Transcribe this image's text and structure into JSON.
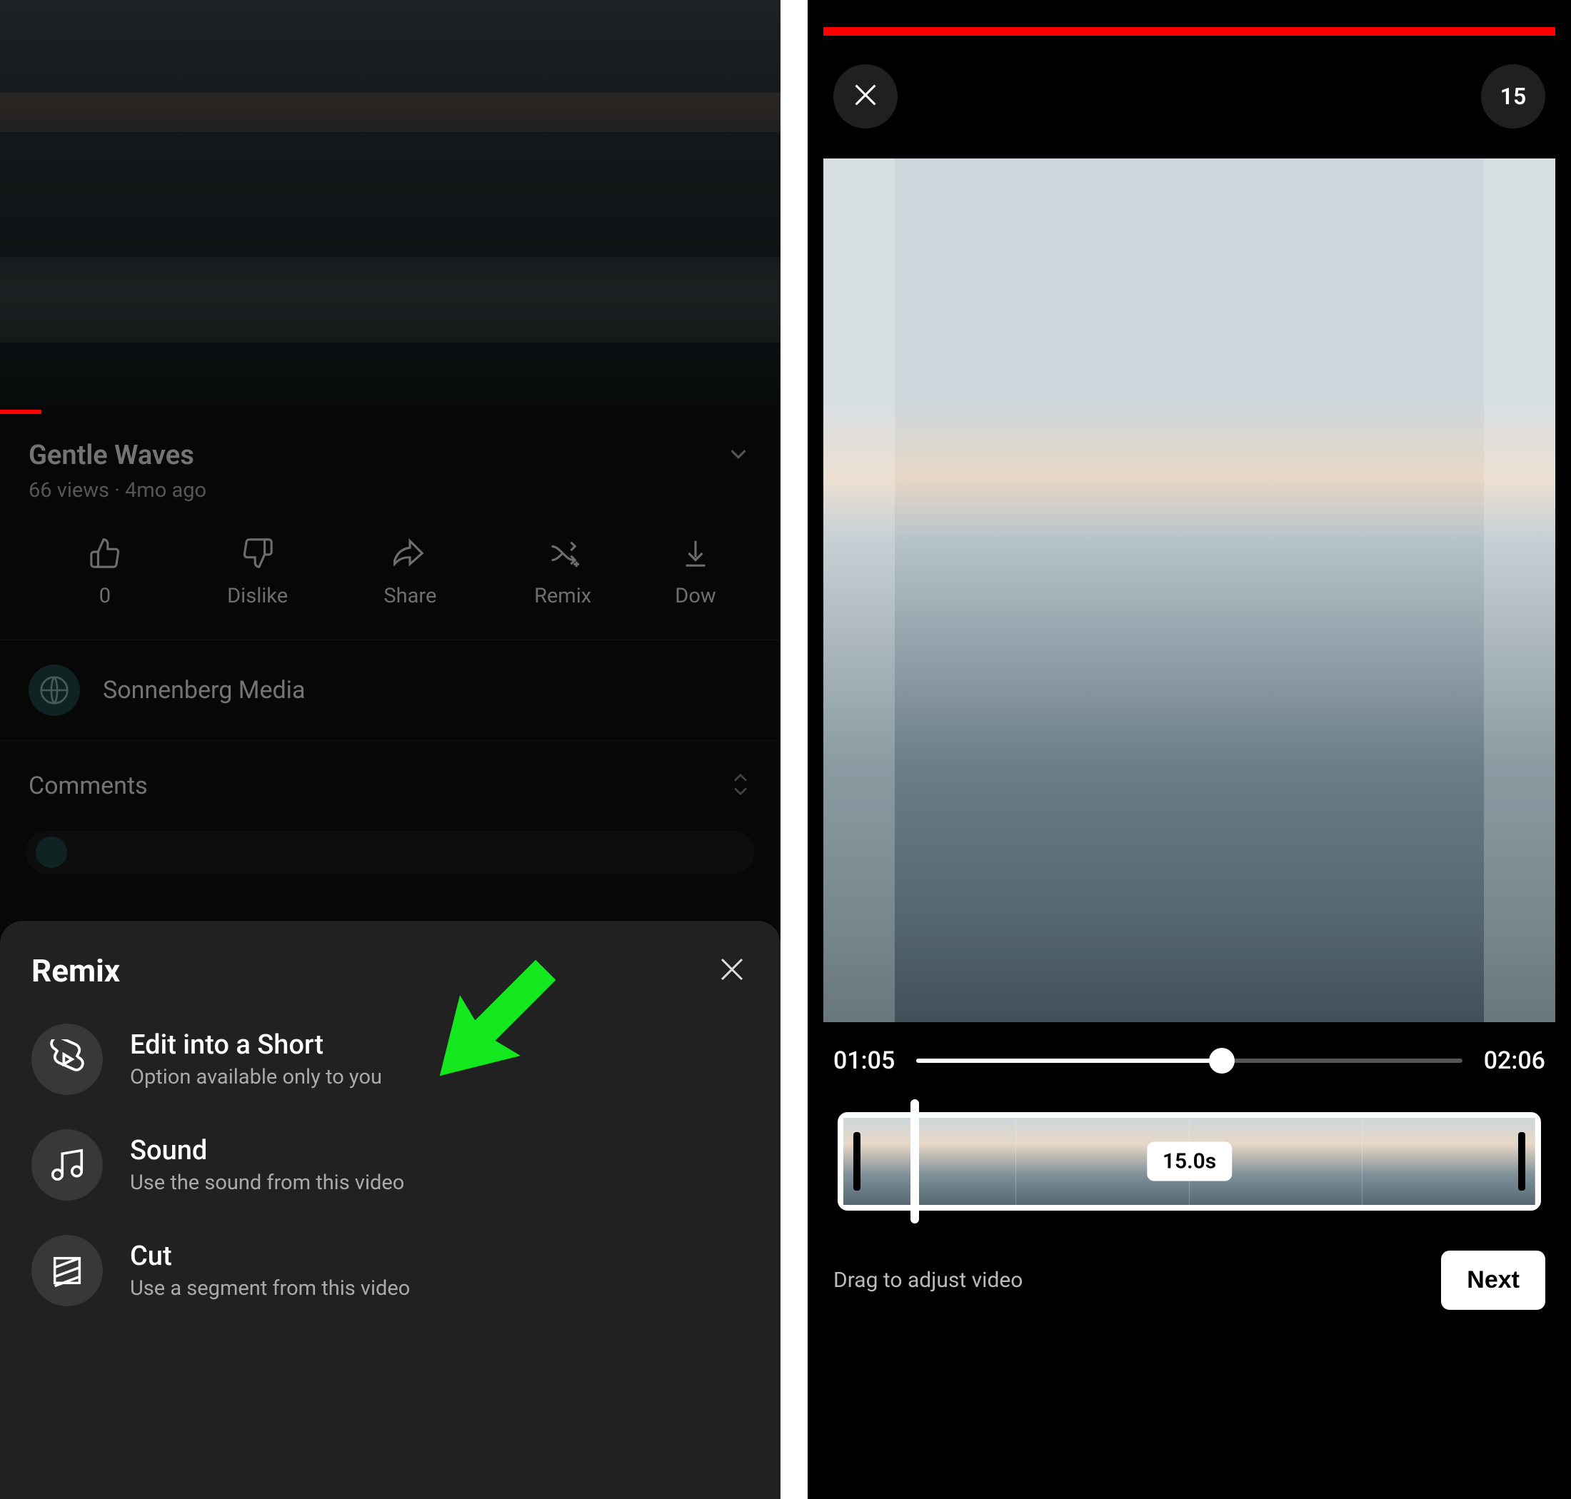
{
  "left": {
    "video": {
      "title": "Gentle Waves",
      "meta": "66 views · 4mo ago"
    },
    "actions": {
      "like": "0",
      "dislike": "Dislike",
      "share": "Share",
      "remix": "Remix",
      "download": "Dow"
    },
    "channel": "Sonnenberg Media",
    "comments_header": "Comments",
    "sheet": {
      "title": "Remix",
      "options": [
        {
          "title": "Edit into a Short",
          "sub": "Option available only to you"
        },
        {
          "title": "Sound",
          "sub": "Use the sound from this video"
        },
        {
          "title": "Cut",
          "sub": "Use a segment from this video"
        }
      ]
    }
  },
  "right": {
    "duration_chip": "15",
    "time_start": "01:05",
    "time_end": "02:06",
    "trim_label": "15.0s",
    "drag_hint": "Drag to adjust video",
    "next_label": "Next"
  }
}
